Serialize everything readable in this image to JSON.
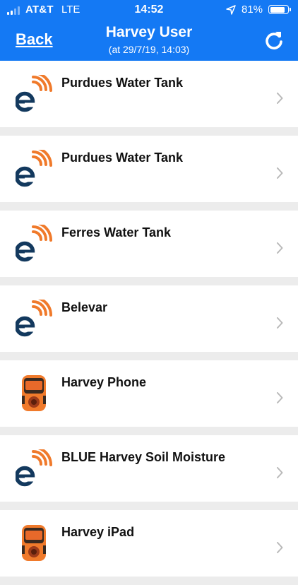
{
  "status_bar": {
    "carrier": "AT&T",
    "network": "LTE",
    "time": "14:52",
    "battery": "81%",
    "battery_level": 0.81
  },
  "nav": {
    "back_label": "Back",
    "title": "Harvey User",
    "subtitle": "(at 29/7/19, 14:03)"
  },
  "colors": {
    "header_bg": "#1479f4",
    "logo_orange": "#f07a2b",
    "logo_navy": "#13395e",
    "separator": "#ececec"
  },
  "devices": [
    {
      "name": "Purdues Water Tank",
      "icon": "eagle-io-logo-icon"
    },
    {
      "name": "Purdues Water Tank",
      "icon": "eagle-io-logo-icon"
    },
    {
      "name": "Ferres Water Tank",
      "icon": "eagle-io-logo-icon"
    },
    {
      "name": "Belevar",
      "icon": "eagle-io-logo-icon"
    },
    {
      "name": "Harvey Phone",
      "icon": "phone-device-icon"
    },
    {
      "name": "BLUE Harvey Soil Moisture",
      "icon": "eagle-io-logo-icon"
    },
    {
      "name": "Harvey iPad",
      "icon": "phone-device-icon"
    }
  ]
}
